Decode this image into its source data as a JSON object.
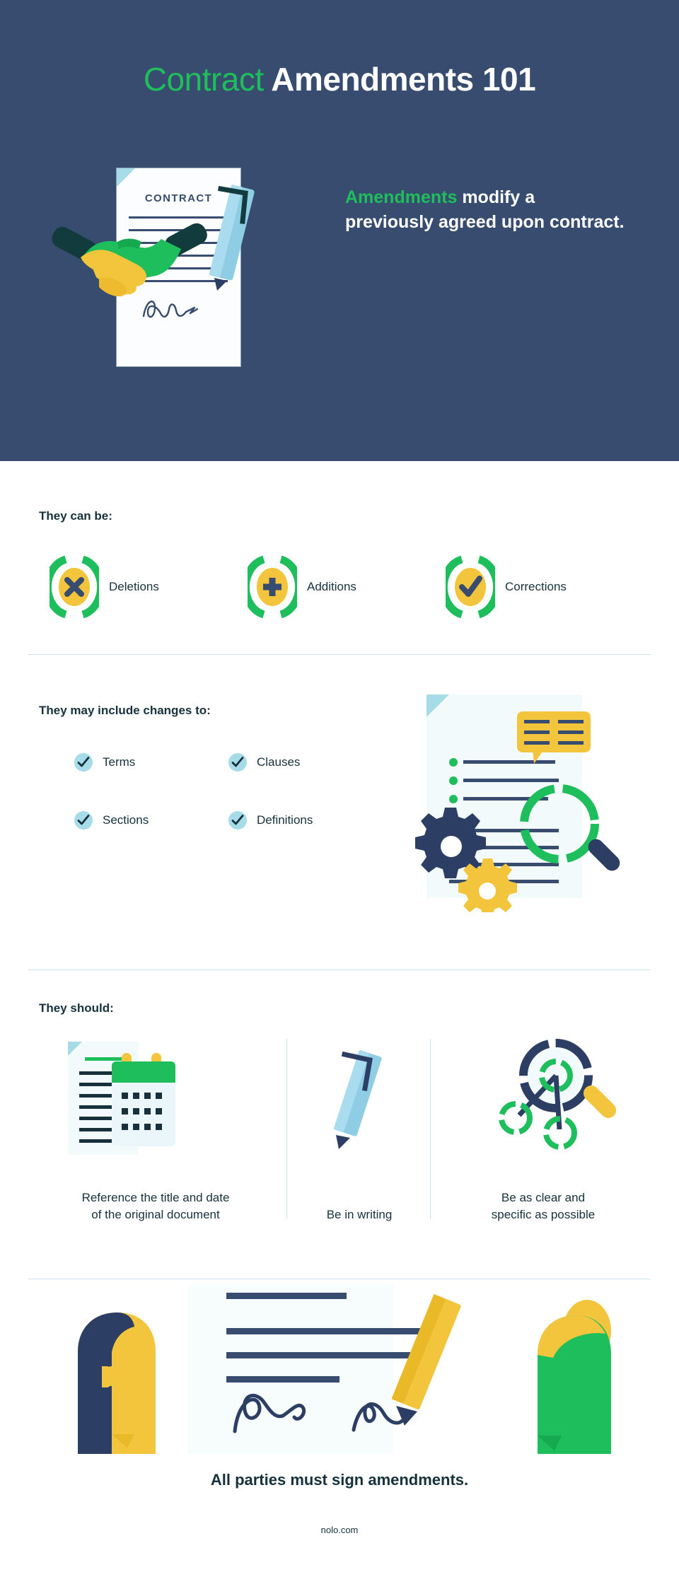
{
  "hero": {
    "title_accent": "Contract",
    "title_rest": " Amendments 101",
    "document_label": "CONTRACT",
    "tagline_accent": "Amendments",
    "tagline_rest": " modify a previously agreed upon contract."
  },
  "can_be": {
    "heading": "They can be:",
    "items": [
      {
        "label": "Deletions",
        "icon": "x-mark-icon"
      },
      {
        "label": "Additions",
        "icon": "plus-icon"
      },
      {
        "label": "Corrections",
        "icon": "check-mark-icon"
      }
    ]
  },
  "changes_to": {
    "heading": "They may include changes to:",
    "items": [
      {
        "label": "Terms"
      },
      {
        "label": "Clauses"
      },
      {
        "label": "Sections"
      },
      {
        "label": "Definitions"
      }
    ]
  },
  "should": {
    "heading": "They should:",
    "items": [
      {
        "caption_line1": "Reference the title and date",
        "caption_line2": "of the original document",
        "icon": "document-calendar-icon"
      },
      {
        "caption_line1": "Be in writing",
        "caption_line2": "",
        "icon": "pencil-icon"
      },
      {
        "caption_line1": "Be as clear and",
        "caption_line2": "specific as possible",
        "icon": "magnifier-network-icon"
      }
    ]
  },
  "footer": {
    "statement": "All parties must sign amendments.",
    "site": "nolo.com"
  },
  "colors": {
    "navy_bg": "#374C6E",
    "dark_navy": "#16313C",
    "green": "#1EBE5C",
    "yellow": "#F2C53D",
    "light_blue": "#A6DCE8",
    "divider": "#CDE4EF",
    "white": "#FFFFFF"
  }
}
